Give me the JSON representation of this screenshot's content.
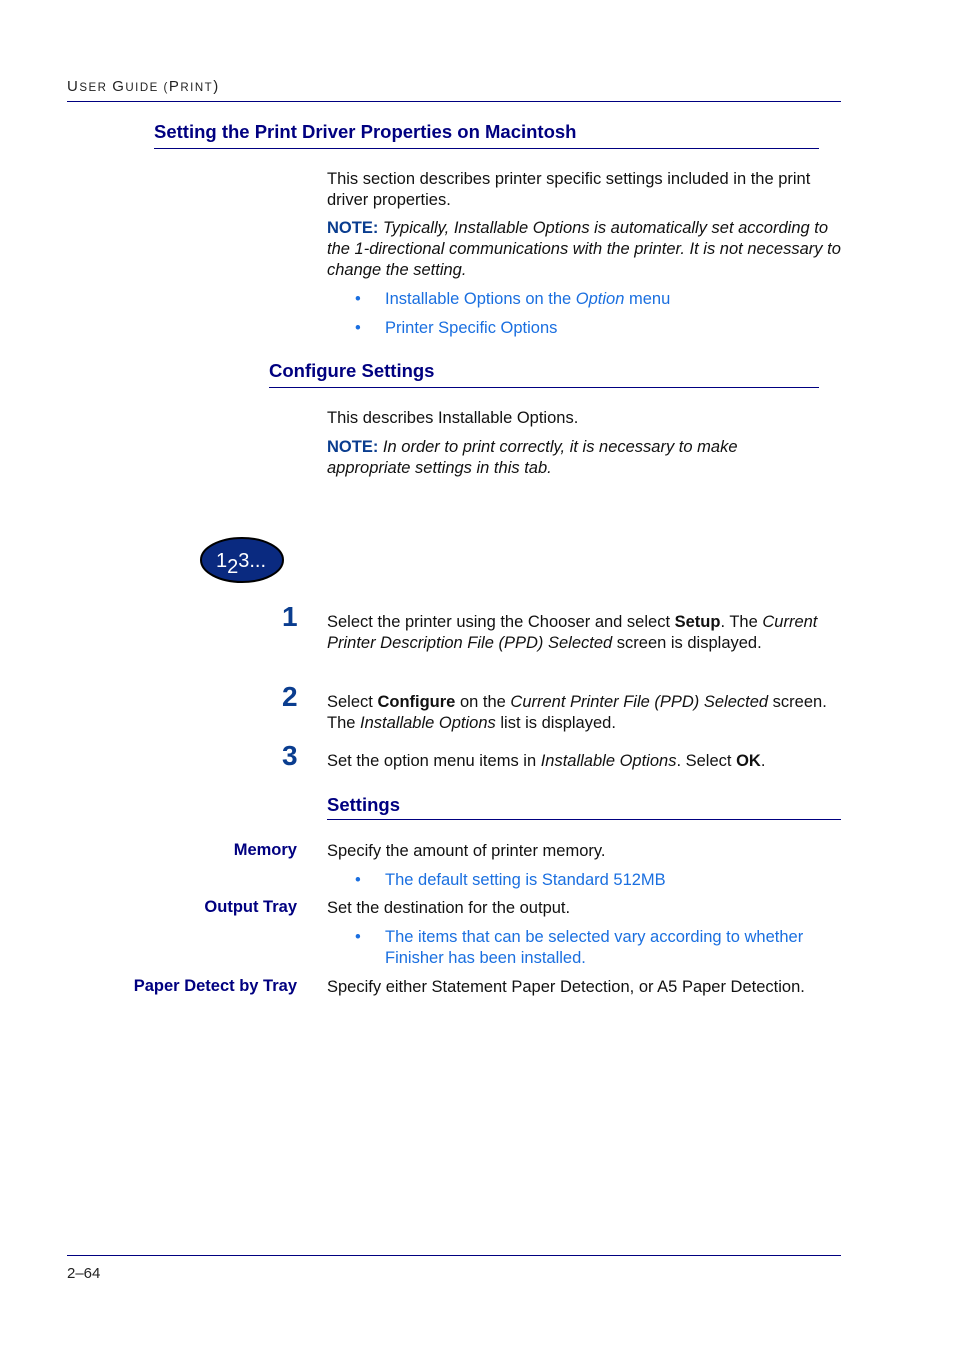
{
  "header": {
    "running_head_prefix": "U",
    "running_head_sc1": "SER ",
    "running_head_G": "G",
    "running_head_sc2": "UIDE (",
    "running_head_P": "P",
    "running_head_sc3": "RINT",
    "running_head_end": ")"
  },
  "section": {
    "title": "Setting the Print Driver Properties on Macintosh",
    "intro": "This section describes printer specific settings included in the print driver properties.",
    "note_label": "NOTE:",
    "note_text": " Typically, Installable Options is automatically set according to the 1-directional communications with the printer. It is not necessary to change the setting.",
    "bullets": [
      {
        "bullet": "•",
        "pre": "Installable Options on the ",
        "italic": "Option",
        "post": " menu"
      },
      {
        "bullet": "•",
        "text": "Printer Specific Options"
      }
    ]
  },
  "configure": {
    "title": "Configure Settings",
    "intro": "This describes Installable Options.",
    "note_label": "NOTE:",
    "note_text": " In order to print correctly, it is necessary to make appropriate settings in this tab."
  },
  "steps_icon": {
    "icon": "numbered-steps-icon",
    "label_1": "1",
    "label_2": "2",
    "label_3": "3..."
  },
  "steps": [
    {
      "num": "1",
      "t1": "Select the printer using the Chooser and select ",
      "b1": "Setup",
      "t2": ". The ",
      "i1": "Current Printer Description File (PPD) Selected",
      "t3": " screen is displayed."
    },
    {
      "num": "2",
      "t1": "Select ",
      "b1": "Configure",
      "t2": " on the ",
      "i1": "Current Printer File (PPD) Selected",
      "t3": " screen. The ",
      "i2": "Installable Options",
      "t4": " list is displayed."
    },
    {
      "num": "3",
      "t1": "Set the option menu items in ",
      "i1": "Installable Options",
      "t2": ". Select ",
      "b1": "OK",
      "t3": "."
    }
  ],
  "settings": {
    "title": "Settings",
    "items": [
      {
        "term": "Memory",
        "desc": "Specify the amount of printer memory.",
        "bullet": "The default setting is Standard 512MB"
      },
      {
        "term": "Output Tray",
        "desc": "Set the destination for the output.",
        "bullet": "The items that can be selected vary according to whether Finisher has been installed."
      },
      {
        "term": "Paper Detect by Tray",
        "desc": "Specify either Statement Paper Detection, or A5 Paper Detection."
      }
    ]
  },
  "footer": {
    "page_number": "2–64"
  }
}
